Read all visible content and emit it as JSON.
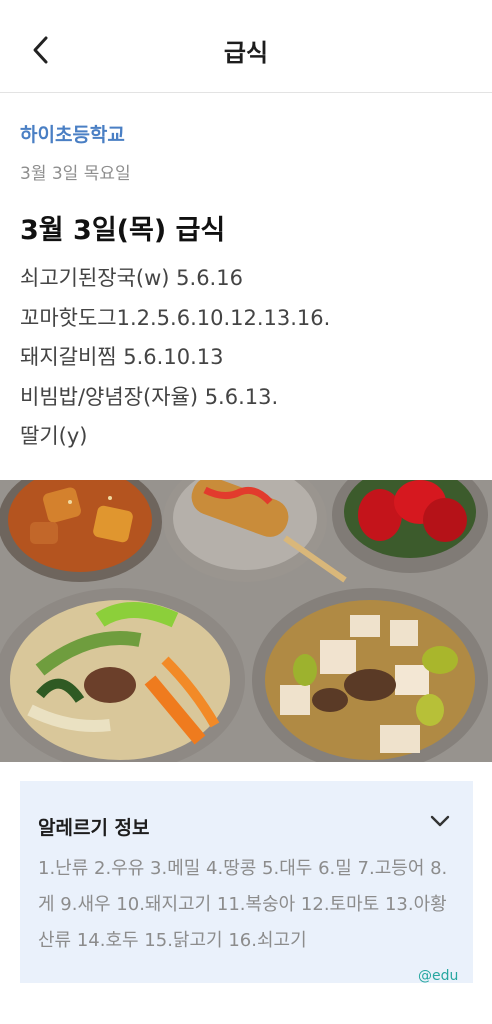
{
  "header": {
    "title": "급식",
    "back_icon": "chevron-left-icon"
  },
  "school": {
    "name": "하이초등학교",
    "date": "3월 3일 목요일"
  },
  "meal": {
    "title": "3월 3일(목) 급식",
    "items": [
      "쇠고기된장국(w) 5.6.16",
      "꼬마핫도그1.2.5.6.10.12.13.16.",
      "돼지갈비찜 5.6.10.13",
      "비빔밥/양념장(자율) 5.6.13.",
      "딸기(y)"
    ]
  },
  "allergy": {
    "title": "알레르기 정보",
    "expand_icon": "chevron-down-icon",
    "text": "1.난류 2.우유 3.메밀 4.땅콩 5.대두 6.밀 7.고등어 8.게 9.새우 10.돼지고기 11.복숭아 12.토마토 13.아황산류 14.호두 15.닭고기 16.쇠고기"
  },
  "watermark": "@edu",
  "colors": {
    "school": "#4a7fc4",
    "allergy_bg": "#eaf1fb",
    "watermark": "#27a7a0"
  }
}
